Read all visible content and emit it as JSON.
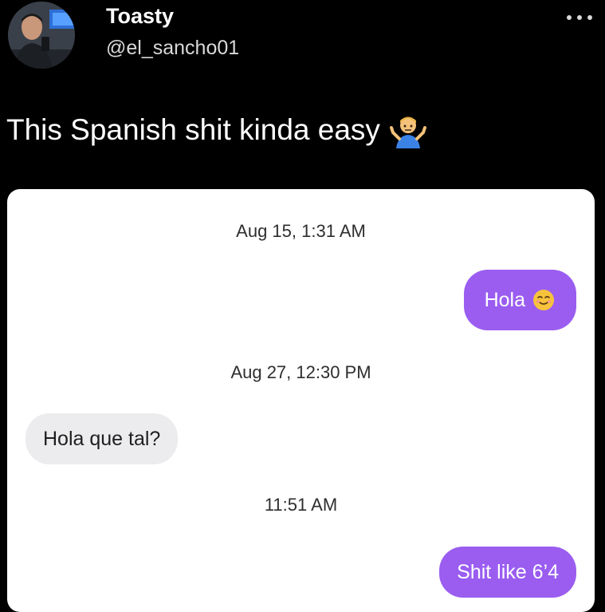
{
  "tweet": {
    "display_name": "Toasty",
    "handle": "@el_sancho01",
    "text": "This Spanish shit kinda easy",
    "text_emoji": "person-shrugging-emoji",
    "menu_icon": "more-options-icon"
  },
  "conversation": {
    "messages": [
      {
        "kind": "timestamp",
        "text": "Aug 15, 1:31 AM"
      },
      {
        "kind": "outgoing",
        "text": "Hola",
        "emoji": "smiling-face-emoji"
      },
      {
        "kind": "timestamp",
        "text": "Aug 27, 12:30 PM"
      },
      {
        "kind": "incoming",
        "text": "Hola que tal?"
      },
      {
        "kind": "timestamp",
        "text": "11:51 AM"
      },
      {
        "kind": "outgoing",
        "text": "Shit like 6’4"
      }
    ]
  },
  "colors": {
    "background": "#000000",
    "card": "#ffffff",
    "outgoing_bubble": "#9a5df0",
    "incoming_bubble": "#ececee"
  }
}
